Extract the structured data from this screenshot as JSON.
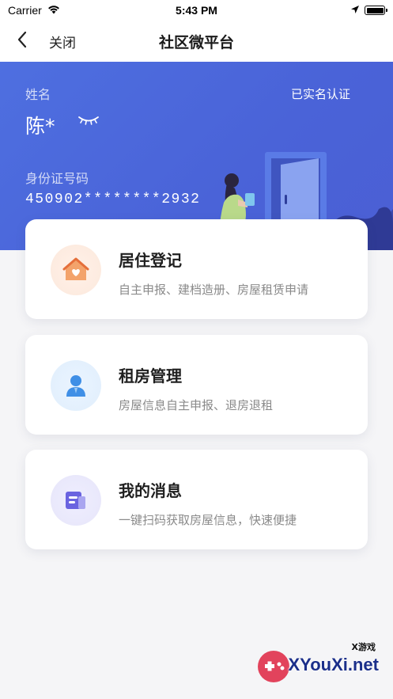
{
  "status_bar": {
    "carrier": "Carrier",
    "time": "5:43 PM"
  },
  "nav": {
    "close_label": "关闭",
    "title": "社区微平台"
  },
  "profile": {
    "name_label": "姓名",
    "name": "陈*",
    "verified": "已实名认证",
    "id_label": "身份证号码",
    "id_number": "450902********2932"
  },
  "cards": [
    {
      "title": "居住登记",
      "desc": "自主申报、建档造册、房屋租赁申请",
      "icon": "home-heart-icon",
      "color": "#f08a4b"
    },
    {
      "title": "租房管理",
      "desc": "房屋信息自主申报、退房退租",
      "icon": "user-icon",
      "color": "#3f8fe6"
    },
    {
      "title": "我的消息",
      "desc": "一键扫码获取房屋信息，快速便捷",
      "icon": "message-icon",
      "color": "#6a63e0"
    }
  ],
  "watermark": {
    "brand": "XYouXi.net",
    "brand_cn": "X游戏"
  }
}
